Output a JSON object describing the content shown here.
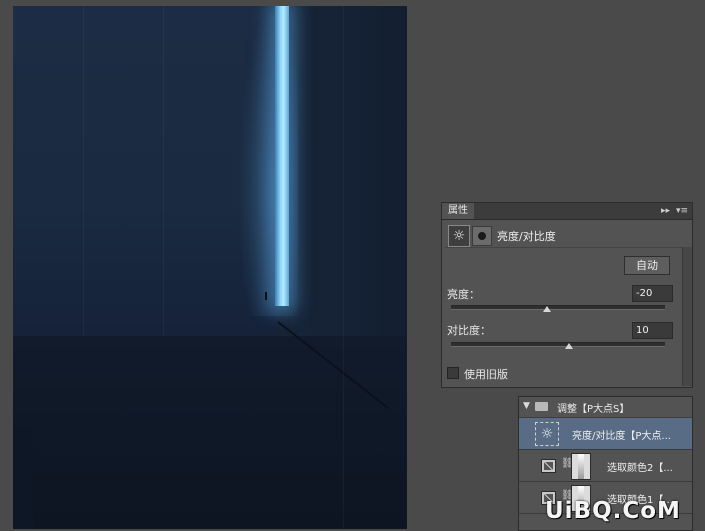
{
  "properties_panel": {
    "tab_label": "属性",
    "collapse_icon": "double-chevron-right-icon",
    "menu_icon": "panel-menu-icon",
    "adjustment_icon": "brightness-sun-icon",
    "mask_icon": "layer-mask-icon",
    "title": "亮度/对比度",
    "auto_button": "自动",
    "brightness": {
      "label": "亮度：",
      "value": "-20",
      "slider_fraction": 0.45
    },
    "contrast": {
      "label": "对比度：",
      "value": "10",
      "slider_fraction": 0.55
    },
    "legacy_checkbox": {
      "label": "使用旧版",
      "checked": false
    }
  },
  "layers_panel": {
    "group": {
      "label": "调整【P大点S】",
      "icon": "folder-icon",
      "expanded": true
    },
    "rows": [
      {
        "label": "亮度/对比度【P大点...",
        "icon": "brightness-sun-icon",
        "selected": true
      },
      {
        "label": "选取颜色2【...",
        "icon": "selective-color-icon",
        "selected": false
      },
      {
        "label": "选取颜色1【...",
        "icon": "selective-color-icon",
        "selected": false
      }
    ]
  },
  "watermark": "UiBQ.CoM",
  "colors": {
    "workspace_bg": "#4a4a4a",
    "panel_bg": "#535353",
    "selected_row": "#596c85",
    "light_slit": "#8fd8ff"
  }
}
